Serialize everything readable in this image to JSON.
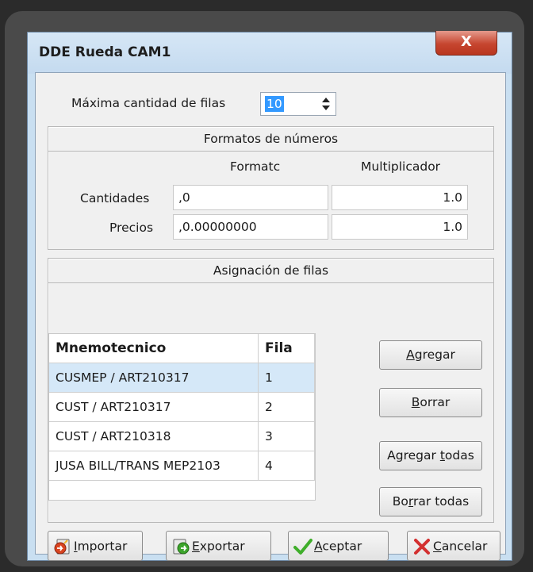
{
  "window": {
    "title": "DDE Rueda CAM1",
    "close_label": "X"
  },
  "max_rows": {
    "label": "Máxima cantidad de filas",
    "value": "10"
  },
  "formats": {
    "header": "Formatos de números",
    "col_format": "Formatc",
    "col_multiplier": "Multiplicador",
    "rows": [
      {
        "label": "Cantidades",
        "format": ",0",
        "multiplier": "1.0"
      },
      {
        "label": "Precios",
        "format": ",0.00000000",
        "multiplier": "1.0"
      }
    ]
  },
  "assignment": {
    "header": "Asignación de filas",
    "columns": [
      "Mnemotecnico",
      "Fila"
    ],
    "rows": [
      {
        "mnemonic": "CUSMEP / ART210317",
        "row": "1",
        "selected": true
      },
      {
        "mnemonic": "CUST / ART210317",
        "row": "2",
        "selected": false
      },
      {
        "mnemonic": "CUST / ART210318",
        "row": "3",
        "selected": false
      },
      {
        "mnemonic": "JUSA BILL/TRANS MEP2103",
        "row": "4",
        "selected": false
      }
    ],
    "buttons": {
      "add": {
        "mnemonic": "A",
        "rest": "gregar"
      },
      "delete": {
        "mnemonic": "B",
        "rest": "orrar"
      },
      "add_all": {
        "pre": "Agregar ",
        "mnemonic": "t",
        "rest": "odas"
      },
      "delete_all": {
        "pre": "Bo",
        "mnemonic": "r",
        "rest": "rar todas"
      }
    }
  },
  "footer": {
    "import": {
      "mnemonic": "I",
      "rest": "mportar",
      "icon": "import-icon"
    },
    "export": {
      "mnemonic": "E",
      "rest": "xportar",
      "icon": "export-icon"
    },
    "accept": {
      "mnemonic": "A",
      "rest": "ceptar",
      "icon": "check-icon"
    },
    "cancel": {
      "mnemonic": "C",
      "rest": "ancelar",
      "icon": "x-icon"
    }
  },
  "colors": {
    "selection": "#d5e8f8",
    "spin_highlight": "#3399ff",
    "cancel_red": "#d32f2f",
    "accept_green": "#3fae2a"
  }
}
